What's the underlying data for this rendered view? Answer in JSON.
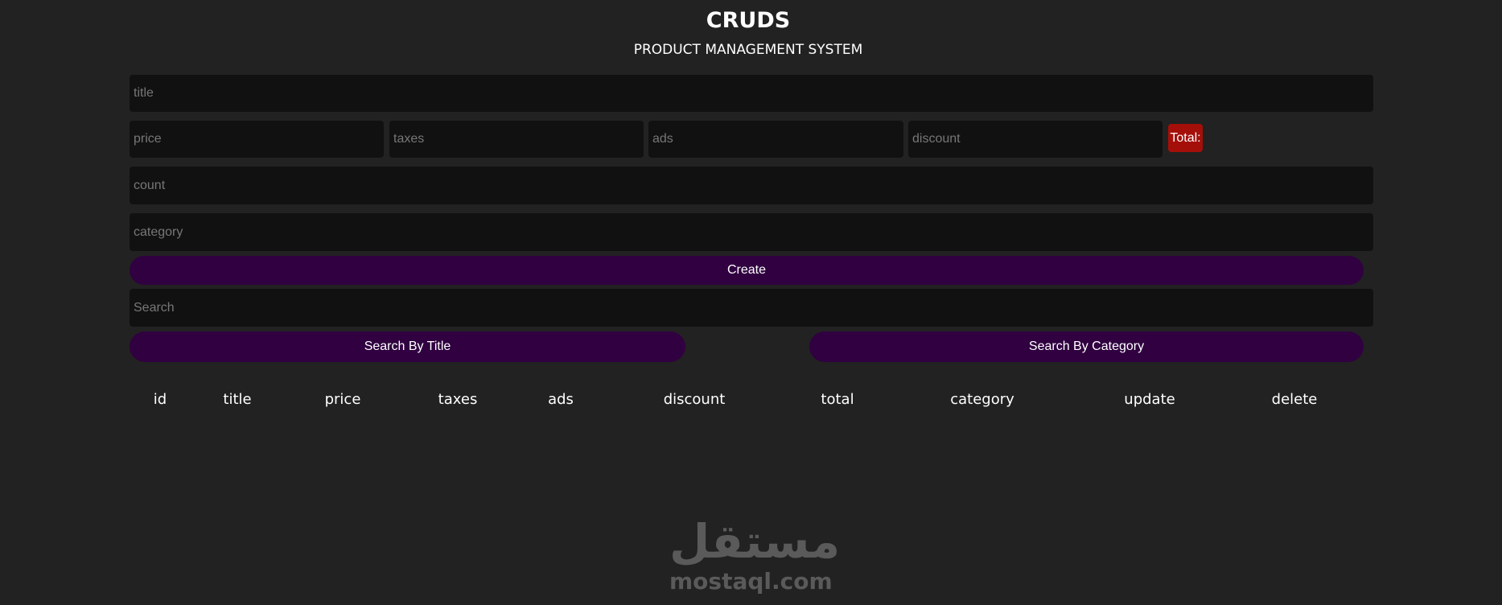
{
  "header": {
    "title": "CRUDS",
    "subtitle": "PRODUCT MANAGEMENT SYSTEM"
  },
  "form": {
    "title_placeholder": "title",
    "price_placeholder": "price",
    "taxes_placeholder": "taxes",
    "ads_placeholder": "ads",
    "discount_placeholder": "discount",
    "total_label": "Total:",
    "count_placeholder": "count",
    "category_placeholder": "category",
    "create_label": "Create"
  },
  "search": {
    "placeholder": "Search",
    "by_title_label": "Search By Title",
    "by_category_label": "Search By Category"
  },
  "table": {
    "headers": [
      "id",
      "title",
      "price",
      "taxes",
      "ads",
      "discount",
      "total",
      "category",
      "update",
      "delete"
    ]
  },
  "watermark": {
    "arabic": "مستقل",
    "latin": "mostaql.com"
  },
  "colors": {
    "background": "#222222",
    "input": "#111111",
    "button": "#300040",
    "total": "#a50f0a"
  }
}
